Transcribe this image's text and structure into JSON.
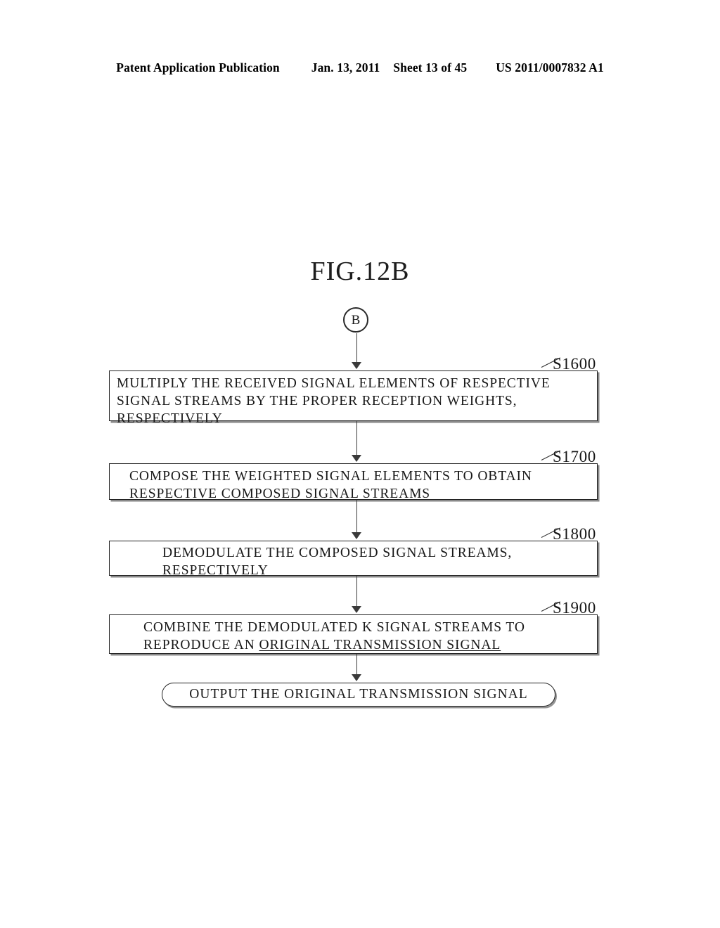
{
  "header": {
    "publication": "Patent Application Publication",
    "date": "Jan. 13, 2011",
    "sheet": "Sheet 13 of 45",
    "patent_number": "US 2011/0007832 A1"
  },
  "figure": {
    "title": "FIG.12B",
    "connector_label": "B",
    "steps": [
      {
        "id": "S1600",
        "ref": "S1600",
        "lines": [
          "MULTIPLY THE RECEIVED SIGNAL ELEMENTS OF RESPECTIVE",
          "SIGNAL STREAMS BY THE PROPER RECEPTION WEIGHTS,",
          "RESPECTIVELY"
        ]
      },
      {
        "id": "S1700",
        "ref": "S1700",
        "lines": [
          "COMPOSE THE WEIGHTED SIGNAL ELEMENTS TO OBTAIN",
          "RESPECTIVE COMPOSED SIGNAL STREAMS"
        ]
      },
      {
        "id": "S1800",
        "ref": "S1800",
        "lines": [
          "DEMODULATE THE COMPOSED SIGNAL STREAMS,",
          "RESPECTIVELY"
        ]
      },
      {
        "id": "S1900",
        "ref": "S1900",
        "lines": [
          "COMBINE THE DEMODULATED K SIGNAL STREAMS TO",
          "REPRODUCE AN ",
          "ORIGINAL TRANSMISSION SIGNAL"
        ]
      }
    ],
    "terminal": "OUTPUT THE ORIGINAL TRANSMISSION SIGNAL"
  }
}
